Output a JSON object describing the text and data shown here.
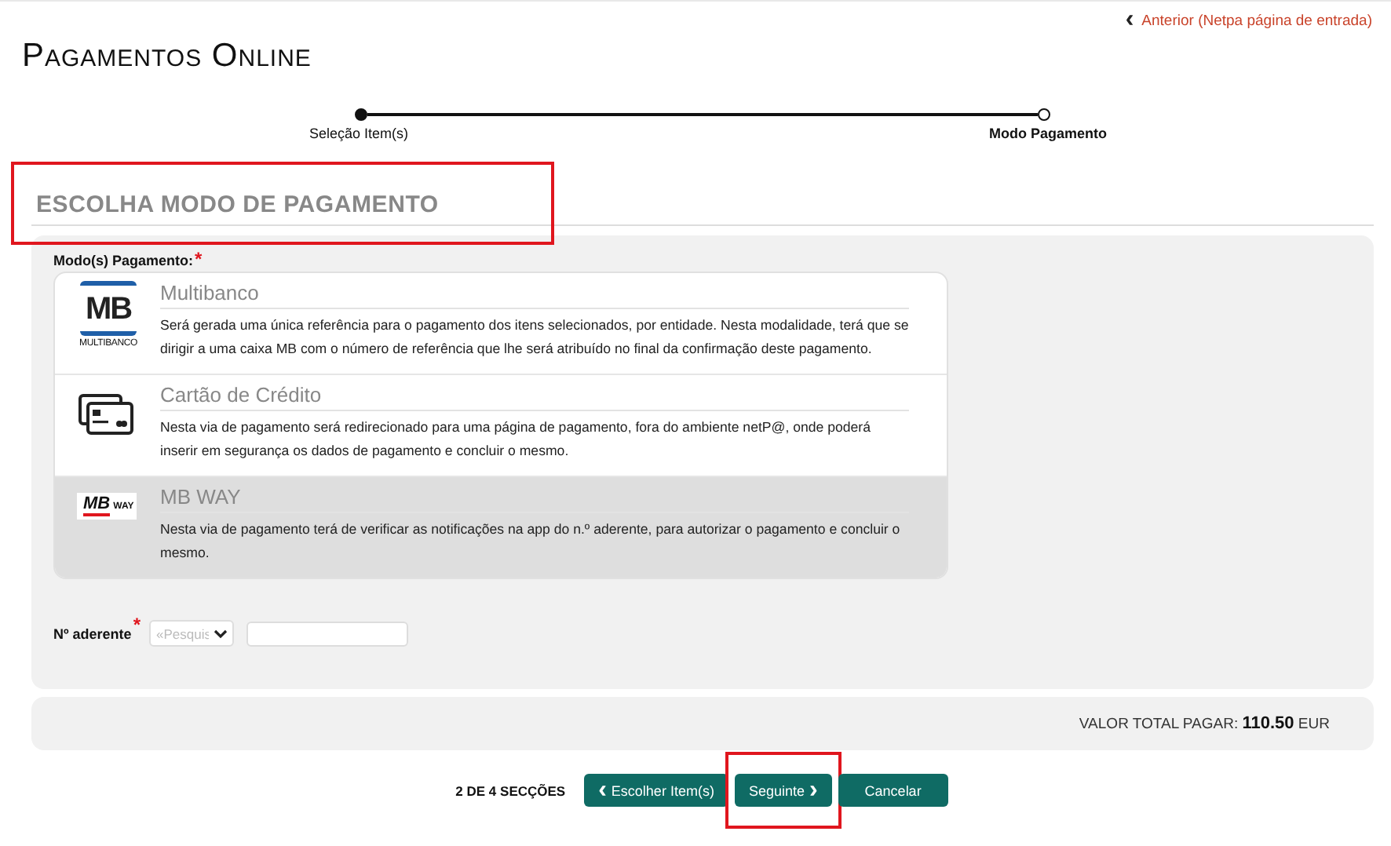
{
  "back_link": {
    "icon": "‹",
    "label": "Anterior (Netpa página de entrada)"
  },
  "page_title": "Pagamentos Online",
  "stepper": [
    {
      "label": "Seleção Item(s)",
      "completed": true,
      "current": false
    },
    {
      "label": "Modo Pagamento",
      "completed": false,
      "current": true
    }
  ],
  "section_title": {
    "text": "ESCOLHA MODO DE PAGAMENTO",
    "highlighted": true
  },
  "payment_modes": {
    "label": "Modo(s) Pagamento:",
    "required_mark": "*",
    "options": [
      {
        "kind": "multibanco",
        "title": "Multibanco",
        "logo_mark": "MB",
        "logo_text": "MULTIBANCO",
        "description": "Será gerada uma única referência para o pagamento dos itens selecionados, por entidade. Nesta modalidade, terá que se dirigir a uma caixa MB com o número de referência que lhe será atribuído no final da confirmação deste pagamento.",
        "selected": false
      },
      {
        "kind": "card",
        "title": "Cartão de Crédito",
        "description": "Nesta via de pagamento será redirecionado para uma página de pagamento, fora do ambiente netP@, onde poderá inserir em segurança os dados de pagamento e concluir o mesmo.",
        "selected": false
      },
      {
        "kind": "mbway",
        "title": "MB WAY",
        "logo_mark": "MB",
        "logo_text": "WAY",
        "description": "Nesta via de pagamento terá de verificar as notificações na app do n.º aderente, para autorizar o pagamento e concluir o mesmo.",
        "selected": true
      }
    ]
  },
  "member_number": {
    "label": "Nº aderente",
    "required_mark": "*",
    "select_placeholder": "«Pesquis"
  },
  "total": {
    "label": "VALOR TOTAL PAGAR:",
    "amount": "110.50",
    "currency": "EUR"
  },
  "footer": {
    "sections": "2 DE 4 SECÇÕES",
    "buttons": [
      {
        "kind": "back",
        "icon": "‹",
        "label": "Escolher Item(s)",
        "highlighted": false
      },
      {
        "kind": "next",
        "icon": "›",
        "label": "Seguinte",
        "highlighted": true
      },
      {
        "kind": "plain",
        "label": "Cancelar",
        "highlighted": false
      }
    ]
  }
}
